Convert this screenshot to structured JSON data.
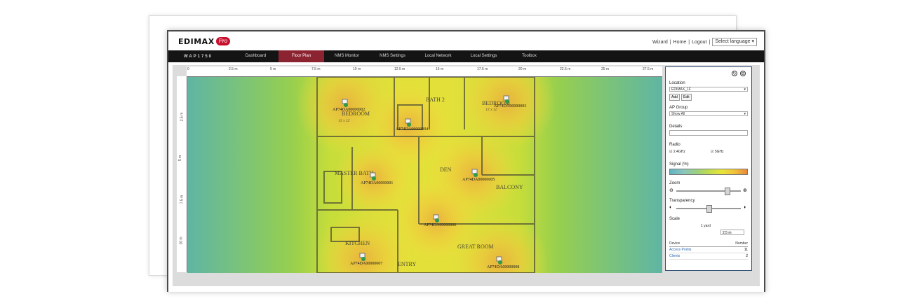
{
  "header": {
    "logo_text": "EDIMAX",
    "logo_badge": "Pro",
    "user_links": [
      "Wizard",
      "Home",
      "Logout"
    ],
    "language": "Select language"
  },
  "nav": {
    "brand": "WAP1750",
    "items": [
      {
        "label": "Dashboard",
        "active": false
      },
      {
        "label": "Floor Plan",
        "active": true
      },
      {
        "label": "NMS Monitor",
        "active": false
      },
      {
        "label": "NMS Settings",
        "active": false
      },
      {
        "label": "Local Network",
        "active": false
      },
      {
        "label": "Local Settings",
        "active": false
      },
      {
        "label": "Toolbox",
        "active": false
      }
    ],
    "active_color": "#8c2331"
  },
  "ruler": {
    "top_ticks": [
      "0",
      "2.5 m",
      "5 m",
      "7.5 m",
      "10 m",
      "12.5 m",
      "15 m",
      "17.5 m",
      "20 m",
      "22.5 m",
      "25 m",
      "27.5 m"
    ],
    "left_ticks": [
      "2.5 m",
      "5 m",
      "7.5 m",
      "10 m"
    ]
  },
  "floorplan": {
    "rooms": [
      "BATH 2",
      "BEDROOM",
      "BEDROOM",
      "MASTER BATH",
      "DEN",
      "BALCONY",
      "KITCHEN",
      "GREAT ROOM",
      "ENTRY"
    ],
    "room_dims": [
      "13' x 12'",
      "13' x 12'"
    ],
    "access_points": [
      "AP74DA00000002",
      "AP74DA00000004",
      "AP74DA00000003",
      "AP74DA00000001",
      "AP74DA00000005",
      "AP74DA00000006",
      "AP74DA00000007",
      "AP74DA00000008"
    ]
  },
  "panel": {
    "location_label": "Location",
    "location_value": "EDIMAX_1F",
    "add_button": "Add",
    "edit_button": "Edit",
    "ap_group_label": "AP Group",
    "ap_group_value": "Show All",
    "details_label": "Details",
    "radio_label": "Radio",
    "radio_options": [
      {
        "label": "2.4GHz",
        "checked": true
      },
      {
        "label": "5GHz",
        "checked": true
      }
    ],
    "signal_label": "Signal (%)",
    "zoom_label": "Zoom",
    "zoom_level": 0.8,
    "transparency_label": "Transparency",
    "transparency_level": 0.5,
    "scale_label": "Scale",
    "scale_unit": "1 yard",
    "scale_value": "2.5 m",
    "table_headers": [
      "Device",
      "Number"
    ],
    "table_rows": [
      {
        "device": "Access Points",
        "number": "11"
      },
      {
        "device": "Clients",
        "number": "2"
      }
    ]
  }
}
